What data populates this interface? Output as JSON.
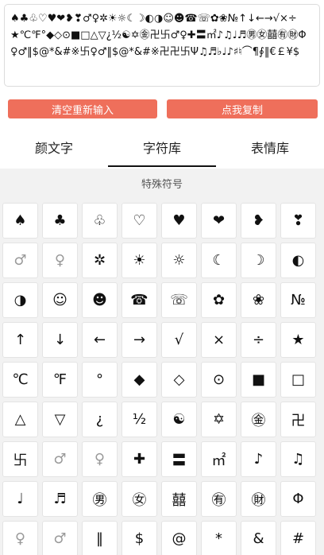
{
  "editor": {
    "value": "♠♣♧♡♥❤❥❣♂♀✲☀☼☾☽◐◑☺☻☎☏✿❀№↑↓←→√×÷★℃℉°◆◇⊙■□△▽¿½☯✡㊎卍卐♂♀✚〓㎡♪♫♩♬㊚㊛囍㊒㊖Φ♀♂‖$@*&#※卐♀♂‖$@*&#※卍卍卐Ψ♫♬♭♩♪♯♮⌒¶∮‖€￡¥$"
  },
  "buttons": {
    "clear_label": "清空重新输入",
    "copy_label": "点我复制"
  },
  "tabs": [
    {
      "label": "颜文字"
    },
    {
      "label": "字符库"
    },
    {
      "label": "表情库"
    }
  ],
  "section": {
    "title": "特殊符号"
  },
  "symbols": [
    "♠",
    "♣",
    "♧",
    "♡",
    "♥",
    "❤",
    "❥",
    "❣",
    "♂",
    "♀",
    "✲",
    "☀",
    "☼",
    "☾",
    "☽",
    "◐",
    "◑",
    "☺",
    "☻",
    "☎",
    "☏",
    "✿",
    "❀",
    "№",
    "↑",
    "↓",
    "←",
    "→",
    "√",
    "×",
    "÷",
    "★",
    "℃",
    "℉",
    "°",
    "◆",
    "◇",
    "⊙",
    "■",
    "□",
    "△",
    "▽",
    "¿",
    "½",
    "☯",
    "✡",
    "㊎",
    "卍",
    "卐",
    "♂",
    "♀",
    "✚",
    "〓",
    "㎡",
    "♪",
    "♫",
    "♩",
    "♬",
    "㊚",
    "㊛",
    "囍",
    "㊒",
    "㊖",
    "Φ",
    "♀",
    "♂",
    "‖",
    "$",
    "@",
    "*",
    "&",
    "#"
  ]
}
